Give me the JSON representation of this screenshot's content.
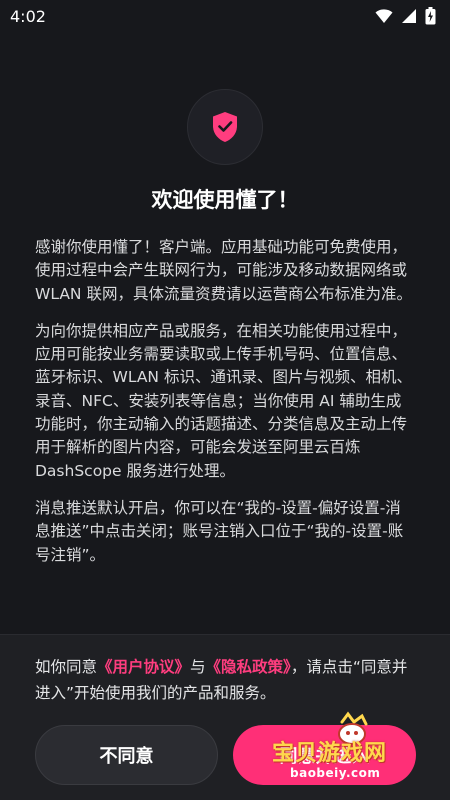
{
  "status_bar": {
    "time": "4:02"
  },
  "dialog": {
    "title": "欢迎使用懂了！",
    "paragraphs": [
      "感谢你使用懂了！客户端。应用基础功能可免费使用，使用过程中会产生联网行为，可能涉及移动数据网络或 WLAN 联网，具体流量资费请以运营商公布标准为准。",
      "为向你提供相应产品或服务，在相关功能使用过程中，应用可能按业务需要读取或上传手机号码、位置信息、蓝牙标识、WLAN 标识、通讯录、图片与视频、相机、录音、NFC、安装列表等信息；当你使用 AI 辅助生成功能时，你主动输入的话题描述、分类信息及主动上传用于解析的图片内容，可能会发送至阿里云百炼 DashScope 服务进行处理。",
      "消息推送默认开启，你可以在“我的-设置-偏好设置-消息推送”中点击关闭；账号注销入口位于“我的-设置-账号注销”。"
    ],
    "consent": {
      "prefix": "如你同意",
      "user_agreement_link": "《用户协议》",
      "and": "与",
      "privacy_policy_link": "《隐私政策》",
      "suffix": "，请点击“同意并进入”开始使用我们的产品和服务。"
    },
    "disagree_label": "不同意",
    "agree_label": "同意并进入"
  },
  "watermark": {
    "text": "宝贝游戏网",
    "url": "baobeiy.com"
  },
  "colors": {
    "accent": "#ff2f77",
    "background": "#17181c",
    "panel": "#1f2024"
  }
}
